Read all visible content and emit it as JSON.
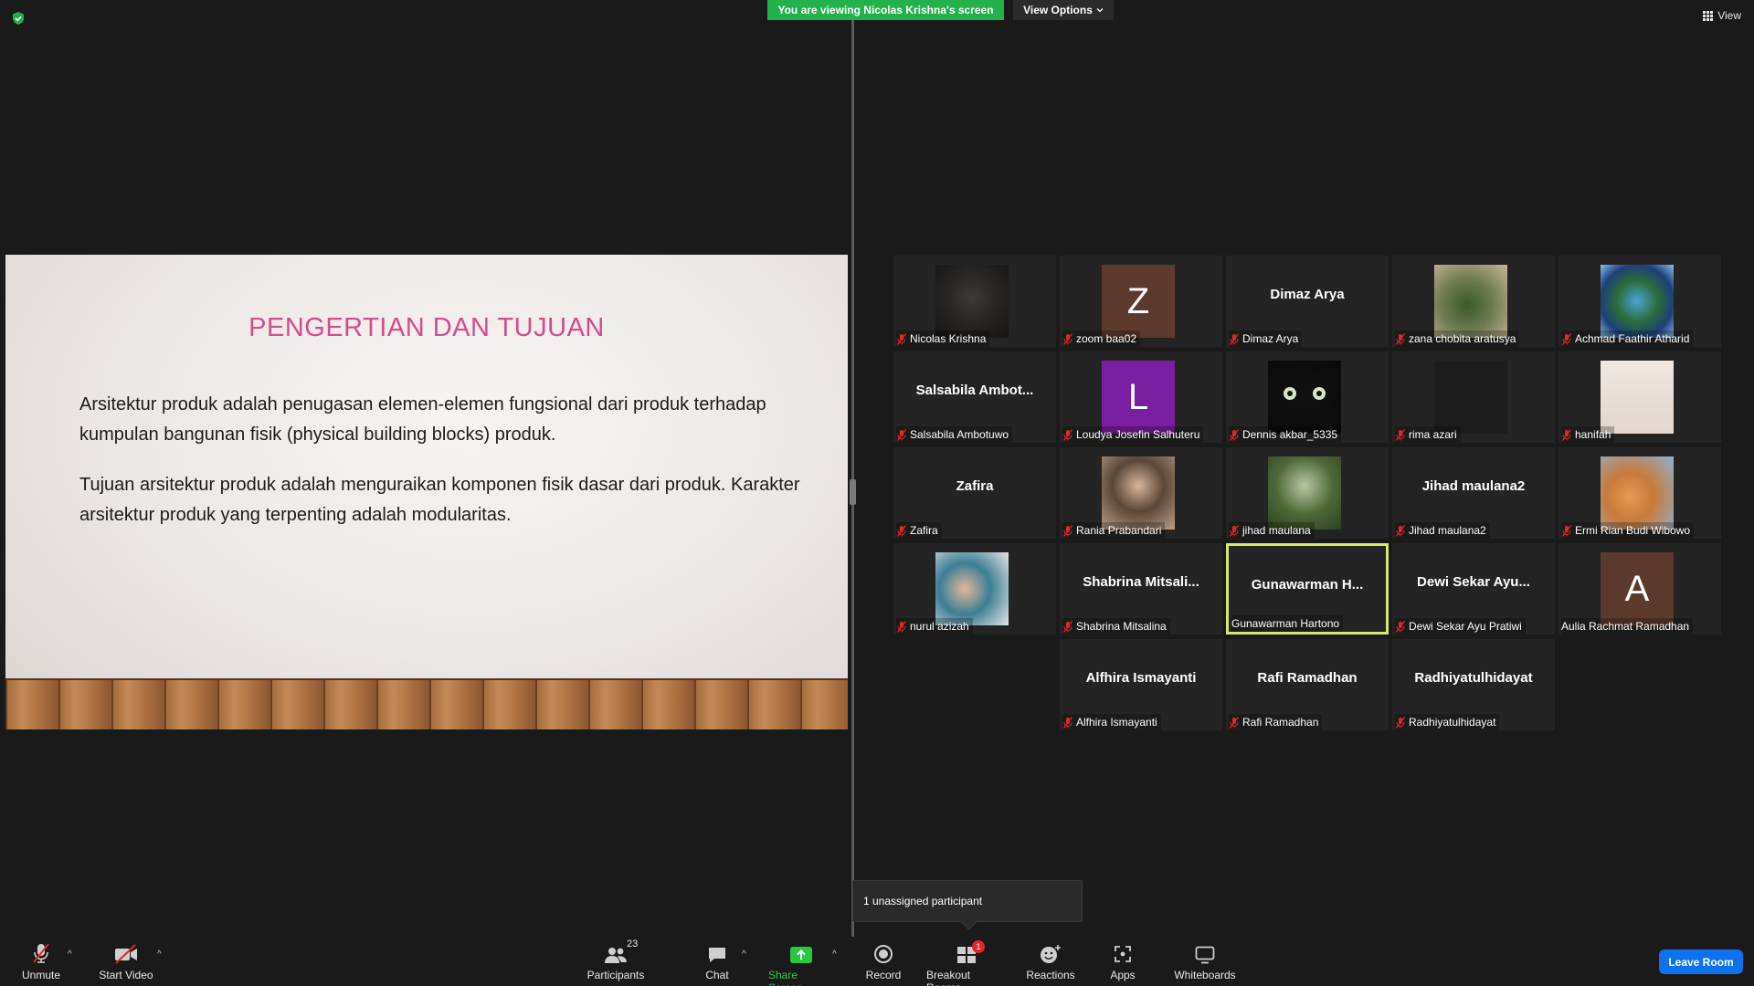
{
  "top_bar": {
    "viewing_banner": "You are viewing Nicolas Krishna's screen",
    "view_options": "View Options",
    "view_button": "View"
  },
  "slide": {
    "title": "PENGERTIAN DAN TUJUAN",
    "paragraph_1": "Arsitektur produk adalah penugasan elemen-elemen fungsional dari produk terhadap kumpulan bangunan fisik (physical building blocks) produk.",
    "paragraph_2": "Tujuan arsitektur produk adalah menguraikan  komponen fisik dasar dari produk. Karakter arsitektur produk yang terpenting adalah modularitas."
  },
  "participants": [
    {
      "caption": "Nicolas Krishna",
      "muted": true,
      "kind": "video"
    },
    {
      "caption": "zoom baa02",
      "muted": true,
      "kind": "letter",
      "letter": "Z",
      "color": "#5c3a2e"
    },
    {
      "caption": "Dimaz Arya",
      "muted": true,
      "kind": "name",
      "display": "Dimaz Arya"
    },
    {
      "caption": "zana chobita aratusya",
      "muted": true,
      "kind": "video"
    },
    {
      "caption": "Achmad Faathir Atharid",
      "muted": true,
      "kind": "video"
    },
    {
      "caption": "Salsabila Ambotuwo",
      "muted": true,
      "kind": "name",
      "display": "Salsabila  Ambot..."
    },
    {
      "caption": "Loudya Josefin Salhuteru",
      "muted": true,
      "kind": "letter",
      "letter": "L",
      "color": "#7b1fa2"
    },
    {
      "caption": "Dennis akbar_5335",
      "muted": true,
      "kind": "video"
    },
    {
      "caption": "rima azari",
      "muted": true,
      "kind": "video"
    },
    {
      "caption": "hanifah",
      "muted": true,
      "kind": "video"
    },
    {
      "caption": "Zafira",
      "muted": true,
      "kind": "name",
      "display": "Zafira"
    },
    {
      "caption": "Rania Prabandari",
      "muted": true,
      "kind": "video"
    },
    {
      "caption": "jihad maulana",
      "muted": true,
      "kind": "video"
    },
    {
      "caption": "Jihad maulana2",
      "muted": true,
      "kind": "name",
      "display": "Jihad maulana2"
    },
    {
      "caption": "Ermi Rian Budi Wibowo",
      "muted": true,
      "kind": "video"
    },
    {
      "caption": "nurul azizah",
      "muted": true,
      "kind": "video"
    },
    {
      "caption": "Shabrina Mitsalina",
      "muted": true,
      "kind": "name",
      "display": "Shabrina  Mitsali..."
    },
    {
      "caption": "Gunawarman Hartono",
      "muted": false,
      "kind": "name",
      "display": "Gunawarman  H...",
      "active": true
    },
    {
      "caption": "Dewi Sekar Ayu Pratiwi",
      "muted": true,
      "kind": "name",
      "display": "Dewi Sekar  Ayu..."
    },
    {
      "caption": "Aulia Rachmat Ramadhan",
      "muted": false,
      "kind": "letter",
      "letter": "A",
      "color": "#5c3a2e"
    },
    {
      "caption": "Alfhira Ismayanti",
      "muted": true,
      "kind": "name",
      "display": "Alfhira Ismayanti"
    },
    {
      "caption": "Rafi Ramadhan",
      "muted": true,
      "kind": "name",
      "display": "Rafi Ramadhan"
    },
    {
      "caption": "Radhiyatulhidayat",
      "muted": true,
      "kind": "name",
      "display": "Radhiyatulhidayat"
    }
  ],
  "popup": {
    "unassigned": "1 unassigned participant"
  },
  "toolbar": {
    "unmute": "Unmute",
    "start_video": "Start Video",
    "participants": "Participants",
    "participants_count": "23",
    "chat": "Chat",
    "share_screen": "Share Screen",
    "record": "Record",
    "breakout_rooms": "Breakout Rooms",
    "breakout_badge": "1",
    "reactions": "Reactions",
    "apps": "Apps",
    "whiteboards": "Whiteboards",
    "leave_room": "Leave Room"
  },
  "colors": {
    "banner_green": "#22b14c",
    "leave_blue": "#0e72ed",
    "active_speaker": "#d9e86a",
    "slide_title": "#d44c8c",
    "muted_red": "#e02828"
  }
}
